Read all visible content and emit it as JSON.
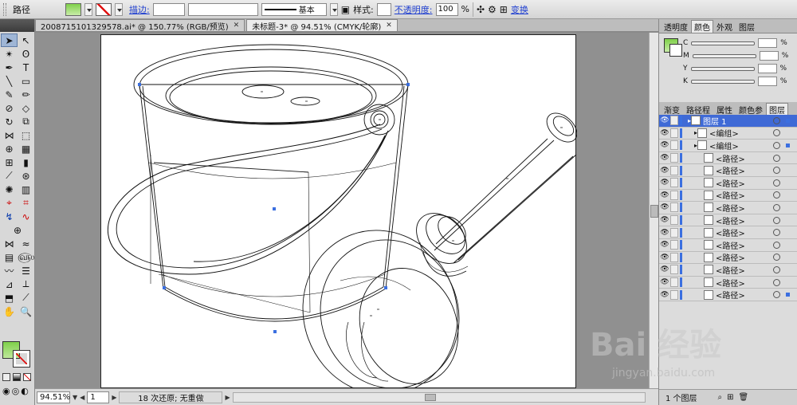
{
  "control_bar": {
    "object_type": "路径",
    "stroke_label": "描边:",
    "stroke_profile": "基本",
    "style_label": "样式:",
    "opacity_label": "不透明度:",
    "opacity_value": "100",
    "opacity_unit": "%",
    "transform_label": "变换"
  },
  "tabs": [
    {
      "label": "2008715101329578.ai* @ 150.77% (RGB/预览)",
      "active": false
    },
    {
      "label": "未标题-3* @ 94.51% (CMYK/轮廓)",
      "active": true
    }
  ],
  "panels": {
    "top_tabs": [
      "透明度",
      "颜色",
      "外观",
      "图层"
    ],
    "color": {
      "channels": [
        "C",
        "M",
        "Y",
        "K"
      ],
      "percent": "%"
    },
    "layer_tabs": [
      "渐变",
      "路径程",
      "属性",
      "颜色参",
      "图层"
    ]
  },
  "layers": [
    {
      "name": "图层 1",
      "indent": 0,
      "highlight": true
    },
    {
      "name": "<编组>",
      "indent": 1,
      "highlight": false
    },
    {
      "name": "<编组>",
      "indent": 1,
      "highlight": false
    },
    {
      "name": "<路径>",
      "indent": 2,
      "highlight": false
    },
    {
      "name": "<路径>",
      "indent": 2,
      "highlight": false
    },
    {
      "name": "<路径>",
      "indent": 2,
      "highlight": false
    },
    {
      "name": "<路径>",
      "indent": 2,
      "highlight": false
    },
    {
      "name": "<路径>",
      "indent": 2,
      "highlight": false
    },
    {
      "name": "<路径>",
      "indent": 2,
      "highlight": false
    },
    {
      "name": "<路径>",
      "indent": 2,
      "highlight": false
    },
    {
      "name": "<路径>",
      "indent": 2,
      "highlight": false
    },
    {
      "name": "<路径>",
      "indent": 2,
      "highlight": false
    },
    {
      "name": "<路径>",
      "indent": 2,
      "highlight": false
    },
    {
      "name": "<路径>",
      "indent": 2,
      "highlight": false
    },
    {
      "name": "<路径>",
      "indent": 2,
      "highlight": false
    }
  ],
  "layer_footer": "1 个图层",
  "status": {
    "zoom": "94.51%",
    "page": "1",
    "history": "18 次还原; 无重做"
  },
  "watermark": {
    "text": "Bai 经验",
    "url": "jingyan.baidu.com"
  },
  "colors": {
    "fill": "#7fd04a",
    "accent": "#1f3fd0",
    "selection": "#3f6ad6",
    "stroke_none": "#e01010"
  }
}
